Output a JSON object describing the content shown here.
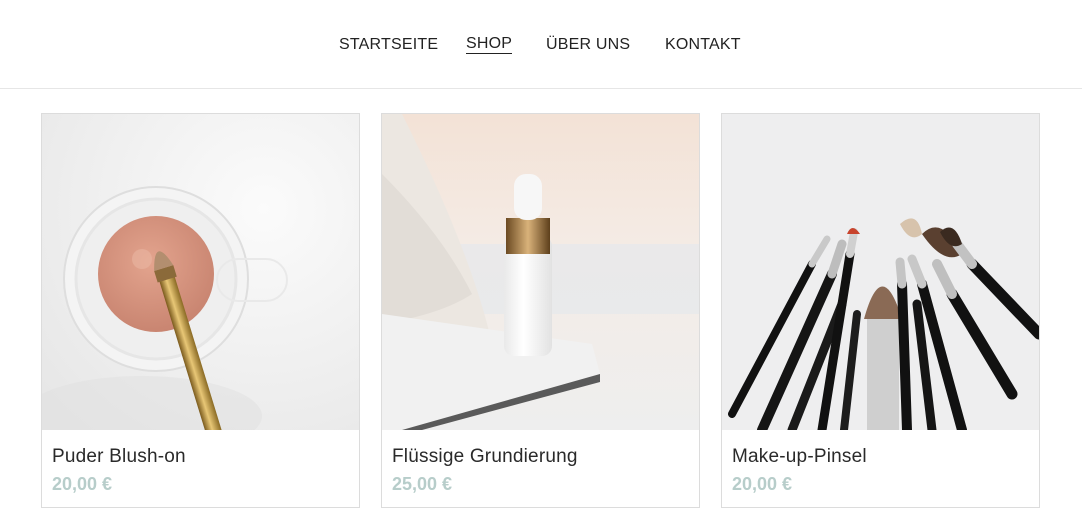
{
  "nav": {
    "items": [
      {
        "label": "STARTSEITE",
        "active": false
      },
      {
        "label": "SHOP",
        "active": true
      },
      {
        "label": "ÜBER UNS",
        "active": false
      },
      {
        "label": "KONTAKT",
        "active": false
      }
    ]
  },
  "products": [
    {
      "title": "Puder Blush-on",
      "price": "20,00 €",
      "image": "blush-powder-jar-with-brush"
    },
    {
      "title": "Flüssige Grundierung",
      "price": "25,00 €",
      "image": "foundation-dropper-bottle"
    },
    {
      "title": "Make-up-Pinsel",
      "price": "20,00 €",
      "image": "makeup-brushes-fan"
    }
  ],
  "colors": {
    "price": "#b7cdca",
    "border": "#dcdcdc",
    "text": "#222222"
  }
}
